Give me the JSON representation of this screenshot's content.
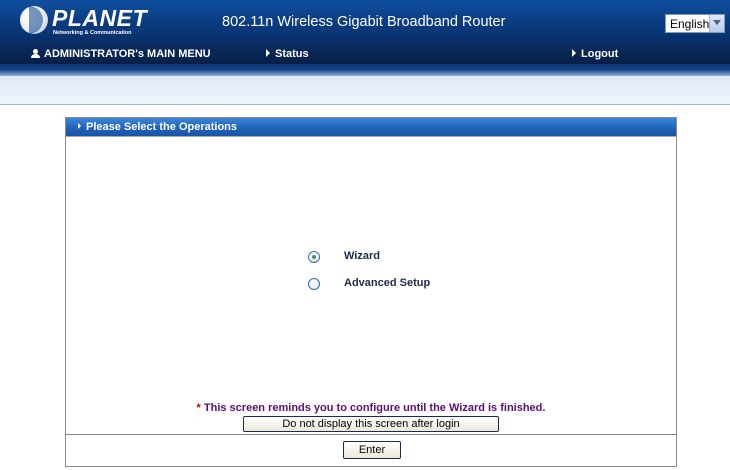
{
  "header": {
    "logo_text": "PLANET",
    "logo_subtitle": "Networking & Communication",
    "product_title": "802.11n Wireless Gigabit Broadband Router",
    "language_select": {
      "value": "English"
    }
  },
  "nav": {
    "admin_menu": "ADMINISTRATOR's MAIN MENU",
    "status": "Status",
    "logout": "Logout"
  },
  "panel": {
    "title": "Please Select the Operations",
    "options": [
      {
        "label": "Wizard",
        "checked": true
      },
      {
        "label": "Advanced Setup",
        "checked": false
      }
    ],
    "notice_star": "*",
    "notice_text": "This screen reminds you to configure until the Wizard is finished.",
    "nodisplay_button": "Do not display this screen after login",
    "enter_button": "Enter"
  },
  "colors": {
    "header_blue": "#0b3f86",
    "panel_header_blue": "#2063b9",
    "notice_purple": "#5a0f78"
  }
}
